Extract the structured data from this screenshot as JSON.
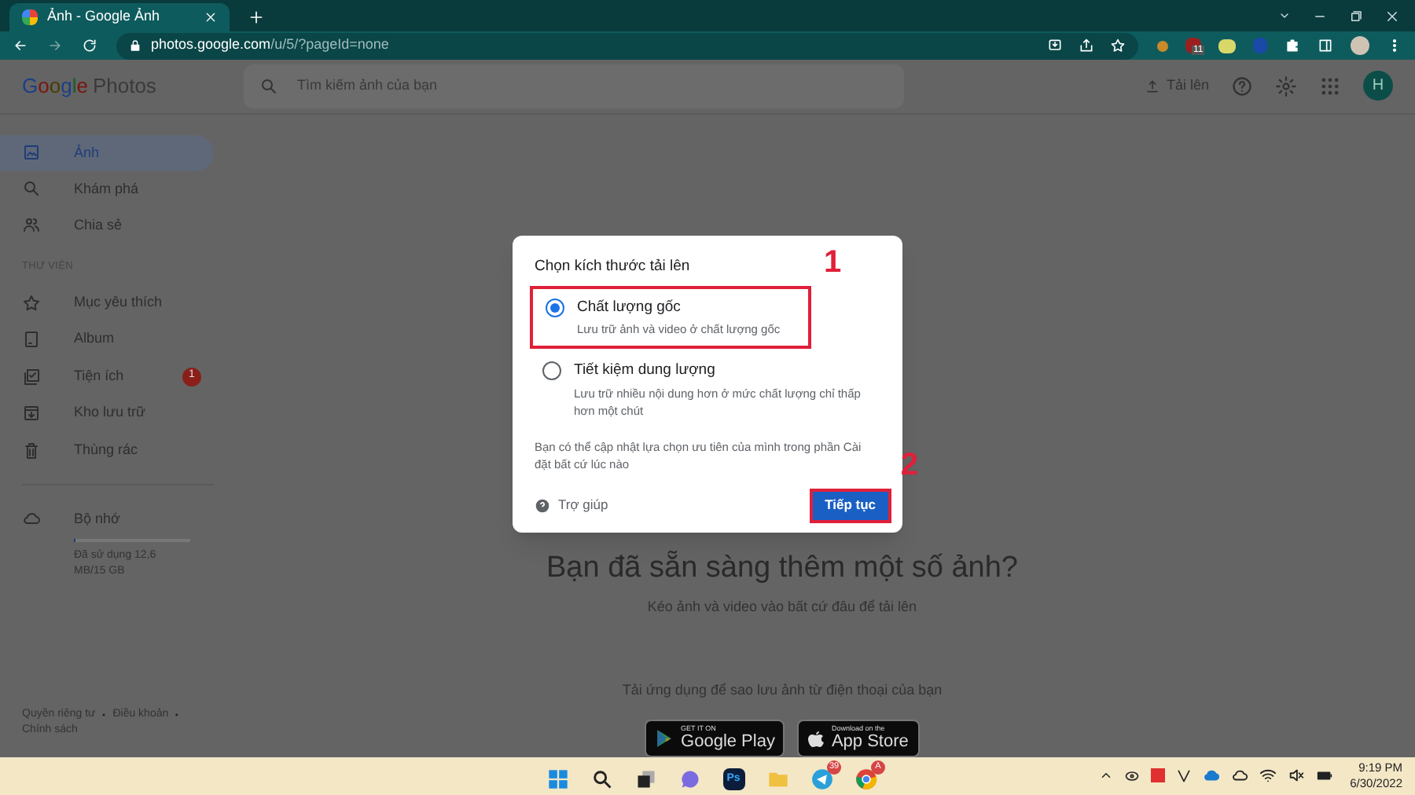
{
  "browser": {
    "tabs": [
      {
        "title": "Ảnh - Google Ảnh",
        "selected": true
      }
    ],
    "url_host": "photos.google.com",
    "url_path": "/u/5/?pageId=none",
    "extension_badge": "11"
  },
  "header": {
    "logo": "Google",
    "logo_product": "Photos",
    "search": {
      "placeholder": "Tìm kiếm ảnh của bạn"
    },
    "upload_label": "Tải lên",
    "avatar_letter": "H"
  },
  "sidebar": {
    "items": [
      {
        "label": "Ảnh",
        "kind": "photo",
        "selected": true
      },
      {
        "label": "Khám phá",
        "kind": "search",
        "selected": false
      },
      {
        "label": "Chia sẻ",
        "kind": "people",
        "selected": false
      }
    ],
    "section_label": "THƯ VIỆN",
    "library": [
      {
        "label": "Mục yêu thích",
        "kind": "star",
        "selected": false
      },
      {
        "label": "Album",
        "kind": "album",
        "selected": false
      },
      {
        "label": "Tiện ích",
        "kind": "utility",
        "selected": false,
        "badge": "1"
      },
      {
        "label": "Kho lưu trữ",
        "kind": "archive",
        "selected": false
      },
      {
        "label": "Thùng rác",
        "kind": "trash",
        "selected": false
      }
    ],
    "storage": {
      "label": "Bộ nhớ",
      "level": 0.001,
      "usage": "Đã sử dụng 12,6 MB/15 GB"
    },
    "footer": [
      {
        "kind": "link",
        "text": "Quyền riêng tư"
      },
      {
        "kind": "separator",
        "text": "·"
      },
      {
        "kind": "link",
        "text": "Điều khoản"
      },
      {
        "kind": "separator",
        "text": "·"
      },
      {
        "kind": "link",
        "text": "Chính sách"
      }
    ]
  },
  "dialog": {
    "title": "Chọn kích thước tải lên",
    "options": [
      {
        "label": "Chất lượng gốc",
        "description": "Lưu trữ ảnh và video ở chất lượng gốc",
        "selected": true,
        "highlight": "1"
      },
      {
        "label": "Tiết kiệm dung lượng",
        "description": "Lưu trữ nhiều nội dung hơn ở mức chất lượng chỉ thấp hơn một chút",
        "selected": false
      }
    ],
    "note": "Bạn có thể cập nhật lựa chọn ưu tiên của mình trong phần Cài đặt bất cứ lúc nào",
    "help": "Trợ giúp",
    "button": "Tiếp tục",
    "button_highlight": "2"
  },
  "main": {
    "heading": "Bạn đã sẵn sàng thêm một số ảnh?",
    "subheading": "Kéo ảnh và video vào bất cứ đâu để tải lên",
    "app_prompt": "Tải ứng dụng để sao lưu ảnh từ điện thoại của bạn",
    "stores": [
      {
        "kind": "play",
        "small": "GET IT ON",
        "big": "Google Play"
      },
      {
        "kind": "apple",
        "small": "Download on the",
        "big": "App Store"
      }
    ]
  },
  "taskbar": {
    "apps": [
      {
        "kind": "windows"
      },
      {
        "kind": "search"
      },
      {
        "kind": "taskview"
      },
      {
        "kind": "chat"
      },
      {
        "kind": "ps",
        "label": "Ps"
      },
      {
        "kind": "folder"
      },
      {
        "kind": "telegram",
        "badge": "39"
      },
      {
        "kind": "chrome",
        "badge": "A"
      }
    ],
    "time": "9:19 PM",
    "date": "6/30/2022"
  }
}
